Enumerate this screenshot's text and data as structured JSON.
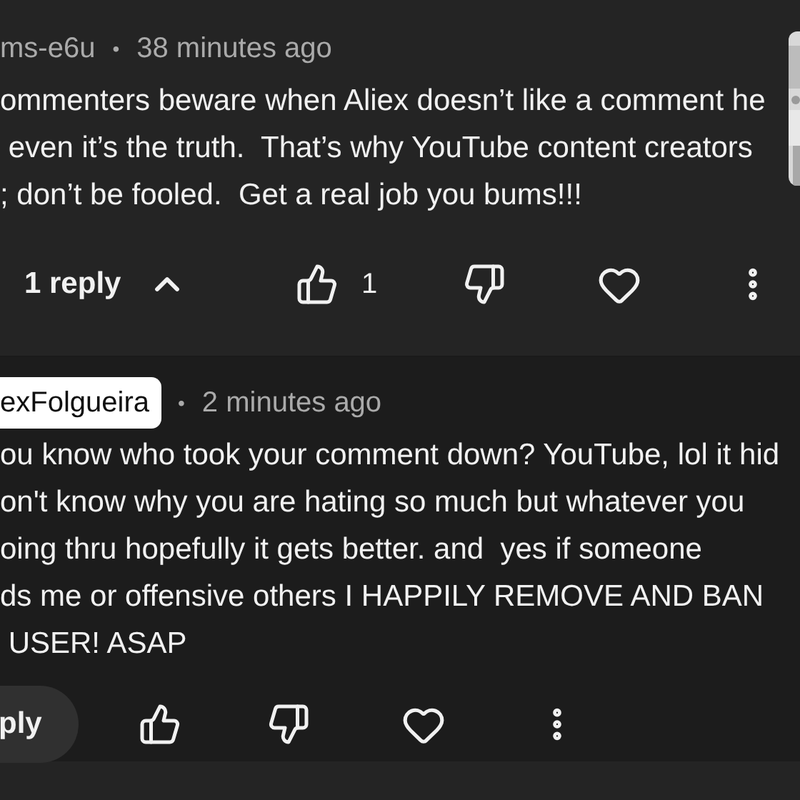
{
  "comments": [
    {
      "author": "ms-e6u",
      "author_highlighted": false,
      "separator": "•",
      "time": "38 minutes ago",
      "text": "ommenters beware when Aliex doesn’t like a comment he\n even it’s the truth.  That’s why YouTube content creators\n; don’t be fooled.  Get a real job you bums!!!",
      "replies_toggle": {
        "label": "1 reply",
        "expanded": true
      },
      "likes": "1"
    },
    {
      "author": "exFolgueira",
      "author_highlighted": true,
      "separator": "•",
      "time": "2 minutes ago",
      "text": "ou know who took your comment down? YouTube, lol it hid\non't know why you are hating so much but whatever you\noing thru hopefully it gets better. and  yes if someone\nds me or offensive others I HAPPILY REMOVE AND BAN\n USER! ASAP",
      "reply_button": "ply"
    }
  ]
}
